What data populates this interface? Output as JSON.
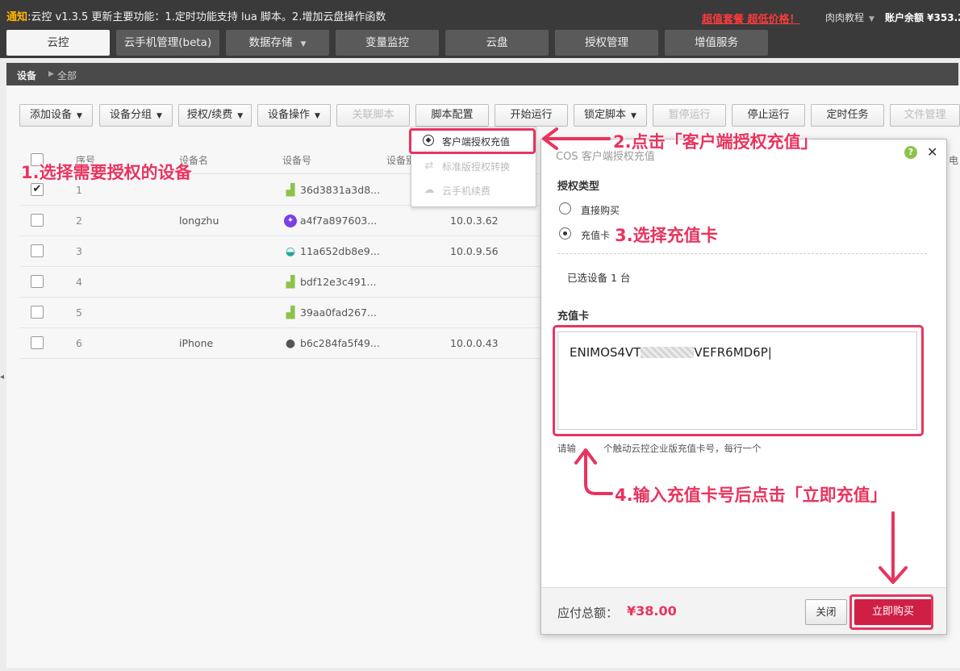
{
  "notice": {
    "label": "通知",
    "text": ":云控 v1.3.5 更新主要功能：1.定时功能支持 lua 脚本。2.增加云盘操作函数",
    "promo": "超值套餐 超低价格！",
    "user": "肉肉教程",
    "balance": "账户余额 ¥353.2"
  },
  "nav": {
    "tabs": [
      {
        "label": "云控",
        "active": true
      },
      {
        "label": "云手机管理(beta)"
      },
      {
        "label": "数据存储",
        "has_caret": true
      },
      {
        "label": "变量监控"
      },
      {
        "label": "云盘"
      },
      {
        "label": "授权管理"
      },
      {
        "label": "增值服务"
      }
    ]
  },
  "breadcrumb": {
    "root": "设备",
    "current": "全部"
  },
  "toolbar": {
    "buttons": [
      {
        "label": "添加设备",
        "caret": true
      },
      {
        "label": "设备分组",
        "caret": true
      },
      {
        "label": "授权/续费",
        "caret": true
      },
      {
        "label": "设备操作",
        "caret": true
      },
      {
        "label": "关联脚本",
        "disabled": true
      },
      {
        "label": "脚本配置"
      },
      {
        "label": "开始运行"
      },
      {
        "label": "锁定脚本",
        "caret": true
      },
      {
        "label": "暂停运行",
        "disabled": true
      },
      {
        "label": "停止运行"
      },
      {
        "label": "定时任务"
      },
      {
        "label": "文件管理",
        "disabled": true
      }
    ]
  },
  "table": {
    "headers": [
      "序号",
      "设备名",
      "设备号",
      "设备别"
    ],
    "rows": [
      {
        "num": "1",
        "name": "",
        "device": "36d3831a3d8...",
        "ip": "",
        "os": "android",
        "checked": true
      },
      {
        "num": "2",
        "name": "longzhu",
        "device": "a4f7a897603...",
        "ip": "10.0.3.62",
        "os": "purple"
      },
      {
        "num": "3",
        "name": "",
        "device": "11a652db8e9...",
        "ip": "10.0.9.56",
        "os": "teal"
      },
      {
        "num": "4",
        "name": "",
        "device": "bdf12e3c491...",
        "ip": "",
        "os": "android"
      },
      {
        "num": "5",
        "name": "",
        "device": "39aa0fad267...",
        "ip": "",
        "os": "android"
      },
      {
        "num": "6",
        "name": "iPhone",
        "device": "b6c284fa5f49...",
        "ip": "10.0.0.43",
        "os": "apple"
      }
    ]
  },
  "dropdown": {
    "items": [
      {
        "label": "客户端授权充值",
        "highlighted": true
      },
      {
        "label": "标准版授权转换",
        "disabled": true
      },
      {
        "label": "云手机续费",
        "disabled": true
      }
    ]
  },
  "dialog": {
    "title": "COS 客户端授权充值",
    "auth_type_label": "授权类型",
    "option_direct": "直接购买",
    "option_card": "充值卡",
    "selected_devices": "已选设备 1 台",
    "card_label": "充值卡",
    "card_value_prefix": "ENIMOS4VT",
    "card_value_suffix": "VEFR6MD6P|",
    "hint_prefix": "请输",
    "hint_suffix": "个触动云控企业版充值卡号，每行一个",
    "total_label": "应付总额：",
    "total_amount": "¥38.00",
    "close_button": "关闭",
    "buy_button": "立即购买",
    "right_edge_text": "电"
  },
  "annotations": {
    "step1": "1.选择需要授权的设备",
    "step2": "2.点击「客户端授权充值」",
    "step3": "3.选择充值卡",
    "step4": "4.输入充值卡号后点击「立即充值」"
  },
  "colors": {
    "accent": "#e8345f",
    "buy_button": "#cf1f45",
    "notice_label": "#ffb400",
    "topbar": "#3a3a3a"
  }
}
